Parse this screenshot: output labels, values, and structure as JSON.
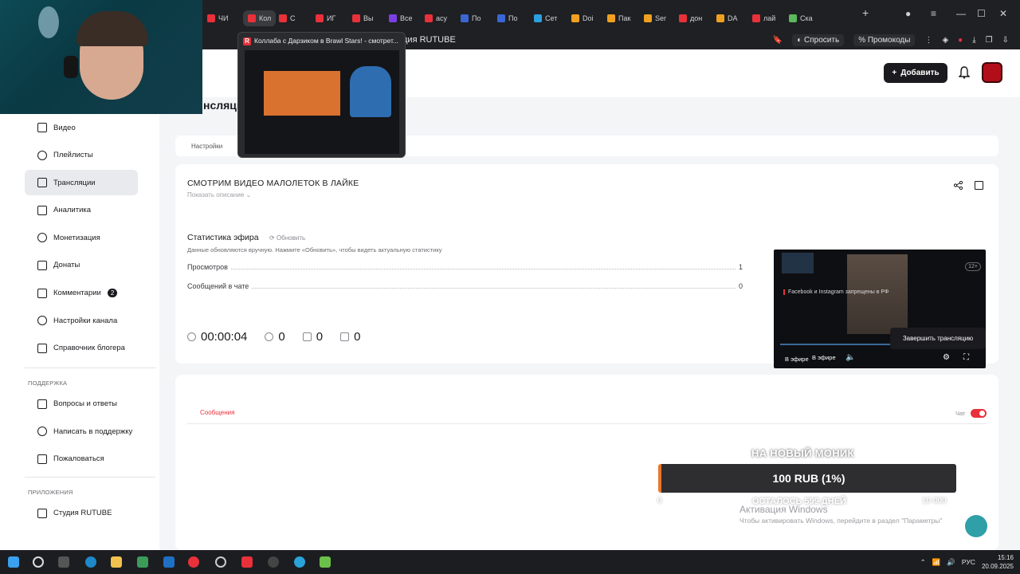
{
  "browser": {
    "tabs": [
      {
        "label": "ЧИ",
        "color": "#e8313b"
      },
      {
        "label": "Кол",
        "color": "#e8313b"
      },
      {
        "label": "С",
        "color": "#e8313b"
      },
      {
        "label": "ИГ",
        "color": "#e8313b"
      },
      {
        "label": "Вы",
        "color": "#e8313b"
      },
      {
        "label": "Все",
        "color": "#7b3fe4"
      },
      {
        "label": "асу",
        "color": "#e8313b"
      },
      {
        "label": "По",
        "color": "#3a66d4"
      },
      {
        "label": "По",
        "color": "#3a66d4"
      },
      {
        "label": "Сет",
        "color": "#2b9fe0"
      },
      {
        "label": "Doi",
        "color": "#f0a020"
      },
      {
        "label": "Пак",
        "color": "#f0a020"
      },
      {
        "label": "Ser",
        "color": "#f0a020"
      },
      {
        "label": "дон",
        "color": "#e8313b"
      },
      {
        "label": "DA",
        "color": "#f0a020"
      },
      {
        "label": "лай",
        "color": "#e8313b"
      },
      {
        "label": "Ска",
        "color": "#5cb85c"
      }
    ],
    "page_title": "дия RUTUBE",
    "ask_label": "Спросить",
    "promo_label": "Промокоды"
  },
  "preview": {
    "title": "Коллаба с Дарзиком в Brawl Stars! - смотрет..."
  },
  "header": {
    "add_label": "Добавить",
    "page_title": "нсляци"
  },
  "sidebar": {
    "items": [
      {
        "label": "Видео",
        "icon": "video-icon"
      },
      {
        "label": "Плейлисты",
        "icon": "playlist-icon"
      },
      {
        "label": "Трансляции",
        "icon": "broadcast-icon"
      },
      {
        "label": "Аналитика",
        "icon": "analytics-icon"
      },
      {
        "label": "Монетизация",
        "icon": "money-icon"
      },
      {
        "label": "Донаты",
        "icon": "donate-icon"
      },
      {
        "label": "Комментарии",
        "icon": "comment-icon",
        "badge": "2"
      },
      {
        "label": "Настройки канала",
        "icon": "gear-icon"
      },
      {
        "label": "Справочник блогера",
        "icon": "help-icon"
      }
    ],
    "support_heading": "ПОДДЕРЖКА",
    "support": [
      {
        "label": "Вопросы и ответы"
      },
      {
        "label": "Написать в поддержку"
      },
      {
        "label": "Пожаловаться"
      }
    ],
    "apps_heading": "ПРИЛОЖЕНИЯ",
    "apps": [
      {
        "label": "Студия RUTUBE"
      }
    ]
  },
  "tabs": {
    "settings_label": "Настройки"
  },
  "stream": {
    "title": "СМОТРИМ ВИДЕО МАЛОЛЕТОК В ЛАЙКЕ",
    "show_description": "Показать описание",
    "stats_title": "Статистика эфира",
    "refresh_label": "Обновить",
    "stats_hint": "Данные обновляются вручную. Нажмите «Обновить», чтобы видеть актуальную статистику",
    "views_label": "Просмотров",
    "views_value": "1",
    "messages_label": "Сообщений в чате",
    "messages_value": "0",
    "duration": "00:00:04",
    "viewers": "0",
    "likes": "0",
    "dislikes": "0",
    "end_button": "Завершить трансляцию"
  },
  "player": {
    "notice": "Facebook и Instagram запрещены в РФ",
    "age": "12+",
    "live_label": "В эфире",
    "live_label2": "В эфире"
  },
  "chat": {
    "messages_tab": "Сообщения",
    "chat_label": "Чат"
  },
  "donation": {
    "title": "НА НОВЫЙ МОНИК",
    "amount": "100 RUB (1%)",
    "progress": 0.01,
    "remaining": "ОСТАЛОСЬ 599 ДНЕЙ",
    "min": "0",
    "max": "10 000"
  },
  "windows": {
    "activation_title": "Активация Windows",
    "activation_text": "Чтобы активировать Windows, перейдите в раздел \"Параметры\"",
    "time": "15:16",
    "date": "20.09.2025",
    "lang": "РУС"
  }
}
